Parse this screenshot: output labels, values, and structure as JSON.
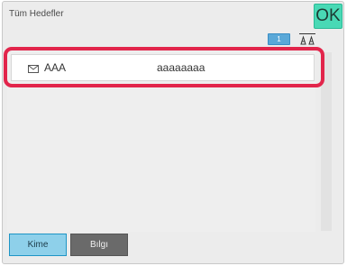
{
  "header": {
    "title": "Tüm Hedefler",
    "ok_label": "OK"
  },
  "pager": {
    "page": "1"
  },
  "icons": {
    "sort": "sort-az-icon",
    "entry_type": "envelope-icon"
  },
  "destinations": [
    {
      "name": "AAA",
      "address": "aaaaaaaa",
      "type": "email"
    }
  ],
  "tabs": [
    {
      "label": "Kime",
      "active": true
    },
    {
      "label": "Bılgı",
      "active": false
    }
  ],
  "colors": {
    "ok_button": "#49d9b5",
    "active_tab": "#8ed0ea",
    "inactive_tab": "#6a6a6a",
    "highlight": "#e2254b",
    "page_badge": "#5aa8d8"
  }
}
